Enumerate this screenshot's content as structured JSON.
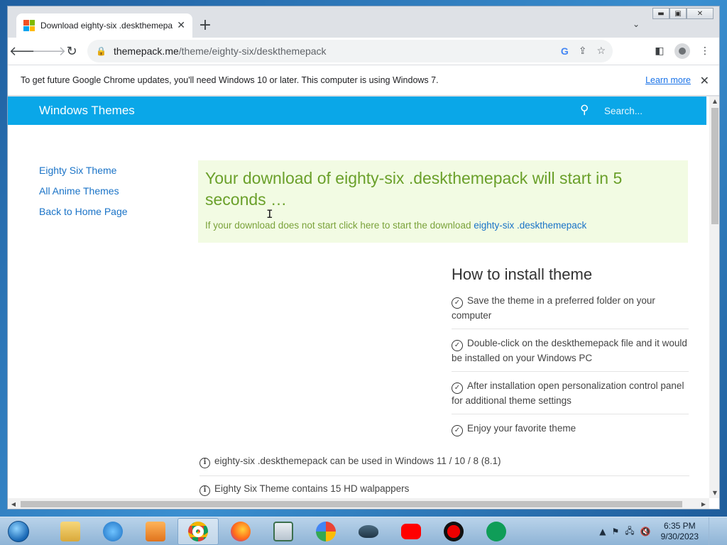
{
  "browser": {
    "tab_title": "Download eighty-six .deskthemepack",
    "tab_close": "✕",
    "new_tab": "+",
    "tab_search": "⌄",
    "url_host": "themepack.me",
    "url_path": "/theme/eighty-six/deskthemepack",
    "icons": [
      "back-arrow-icon",
      "forward-arrow-icon",
      "reload-icon",
      "lock-icon",
      "google-lens-icon",
      "share-icon",
      "star-icon",
      "side-panel-icon",
      "profile-icon",
      "menu-icon"
    ]
  },
  "window_controls": {
    "minimize": "▬",
    "maximize": "▣",
    "close": "✕"
  },
  "infobar": {
    "message": "To get future Google Chrome updates, you'll need Windows 10 or later. This computer is using Windows 7.",
    "link": "Learn more",
    "close": "✕"
  },
  "site": {
    "brand": "Windows Themes",
    "search_placeholder": "Search...",
    "header_color": "#0aa7e8",
    "nav": [
      {
        "label": "Eighty Six Theme"
      },
      {
        "label": "All Anime Themes"
      },
      {
        "label": "Back to Home Page"
      }
    ],
    "notice": {
      "headline": "Your download of eighty-six .deskthemepack will start in 5 seconds …",
      "sub_text": "If your download does not start click here to start the download ",
      "sub_link": "eighty-six .deskthemepack"
    },
    "howto": {
      "title": "How to install theme",
      "steps": [
        "Save the theme in a preferred folder on your computer",
        "Double-click on the deskthemepack file and it would be installed on your Windows PC",
        "After installation open personalization control panel for additional theme settings",
        "Enjoy your favorite theme"
      ]
    },
    "info": [
      "eighty-six .deskthemepack can be used in Windows 11 / 10 / 8 (8.1)",
      "Eighty Six Theme contains 15 HD walpappers"
    ]
  },
  "taskbar": {
    "apps": [
      "file-explorer",
      "internet-explorer",
      "media-player",
      "chrome",
      "firefox",
      "notepad-app",
      "google",
      "ufo-app",
      "youtube",
      "recorder",
      "hangouts"
    ],
    "time": "6:35 PM",
    "date": "9/30/2023"
  }
}
